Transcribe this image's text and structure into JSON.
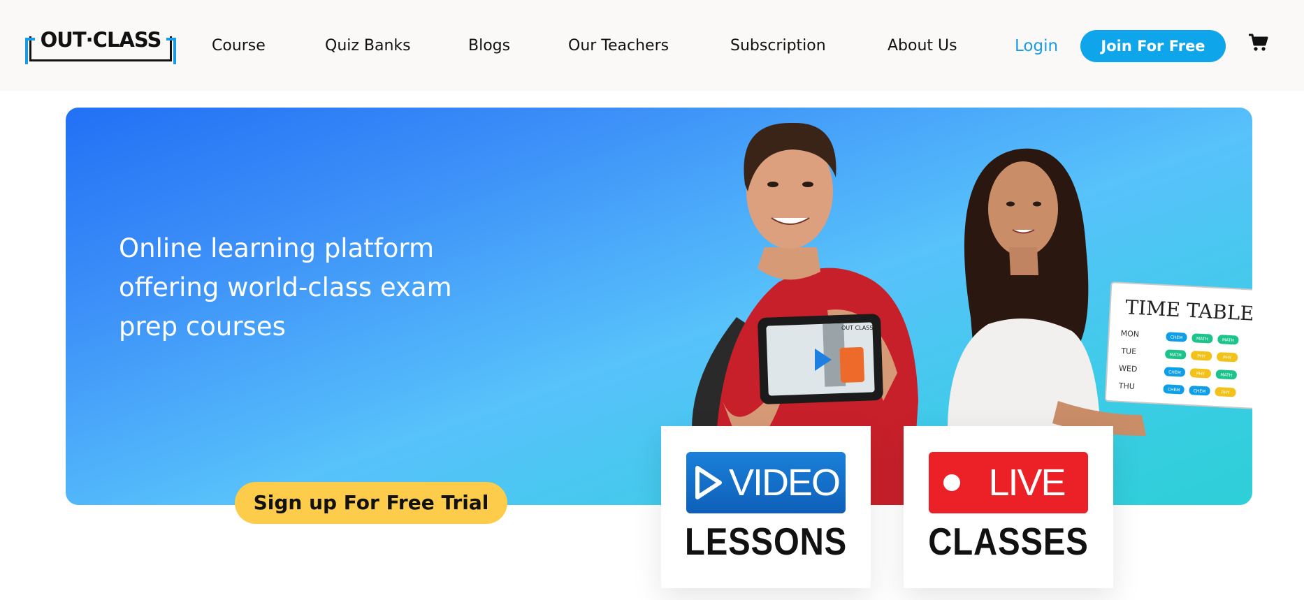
{
  "header": {
    "logo_text": "OUT·CLASS",
    "nav": [
      {
        "label": "Course"
      },
      {
        "label": "Quiz Banks"
      },
      {
        "label": "Blogs"
      },
      {
        "label": "Our Teachers"
      },
      {
        "label": "Subscription"
      },
      {
        "label": "About Us"
      }
    ],
    "login_label": "Login",
    "join_label": "Join For Free",
    "cart_icon": "cart-icon"
  },
  "hero": {
    "headline": "Online learning platform offering world-class exam prep courses",
    "cta_label": "Sign up For Free Trial",
    "photo_tablet_label": "OUT CLASS",
    "timetable": {
      "title": "TIME TABLE",
      "rows": [
        {
          "day": "MON",
          "subjects": [
            "CHEM",
            "MATH",
            "MATH"
          ]
        },
        {
          "day": "TUE",
          "subjects": [
            "MATH",
            "PHY",
            "PHY"
          ]
        },
        {
          "day": "WED",
          "subjects": [
            "CHEM",
            "PHY",
            "MATH"
          ]
        },
        {
          "day": "THU",
          "subjects": [
            "CHEM",
            "CHEM",
            "PHY"
          ]
        }
      ]
    }
  },
  "cards": [
    {
      "badge": "VIDEO",
      "label": "LESSONS",
      "icon": "play-icon"
    },
    {
      "badge": "LIVE",
      "label": "CLASSES",
      "icon": "live-dot-icon"
    }
  ],
  "colors": {
    "accent": "#0ea5ea",
    "cta_yellow": "#fccc4a",
    "video_blue": "#1a80d9",
    "live_red": "#ec2027"
  }
}
